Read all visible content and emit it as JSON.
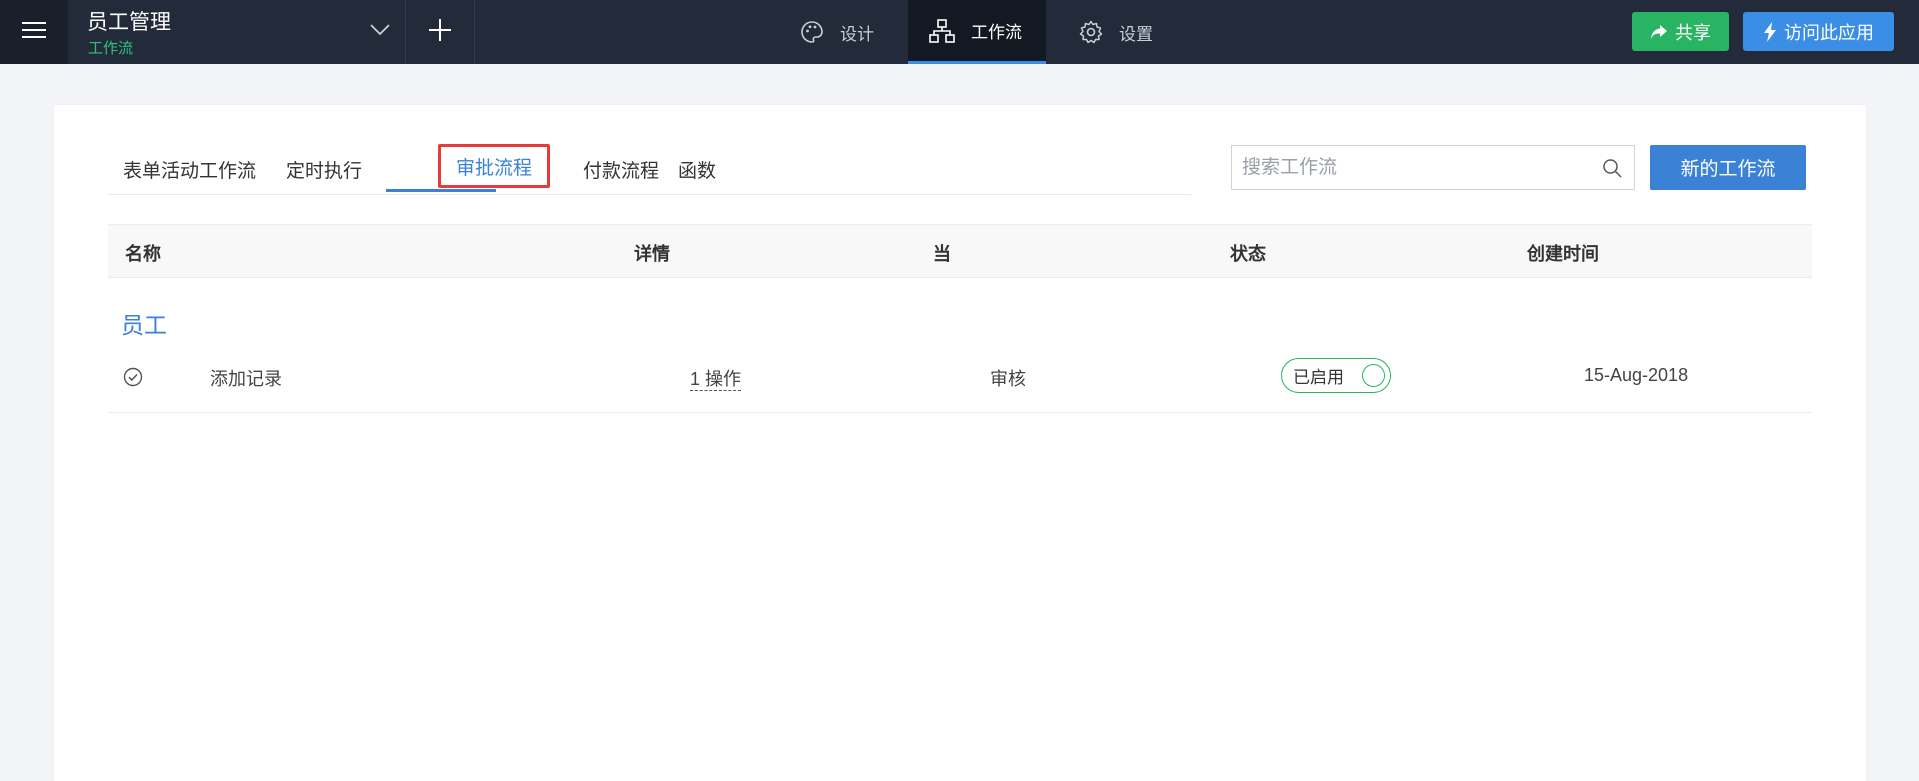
{
  "header": {
    "app_title": "员工管理",
    "app_subtitle": "工作流",
    "nav": [
      {
        "label": "设计",
        "icon": "palette-icon"
      },
      {
        "label": "工作流",
        "icon": "workflow-icon",
        "active": true
      },
      {
        "label": "设置",
        "icon": "gear-icon"
      }
    ],
    "share_label": "共享",
    "visit_label": "访问此应用",
    "colors": {
      "bar": "#232b3a",
      "share": "#28b463",
      "visit": "#3b8ee6"
    }
  },
  "subtabs": [
    {
      "label": "表单活动工作流"
    },
    {
      "label": "定时执行"
    },
    {
      "label": "审批流程",
      "active": true
    },
    {
      "label": "付款流程"
    },
    {
      "label": "函数"
    }
  ],
  "search": {
    "placeholder": "搜索工作流"
  },
  "new_button_label": "新的工作流",
  "table": {
    "columns": [
      "名称",
      "详情",
      "当",
      "状态",
      "创建时间"
    ],
    "group": "员工",
    "rows": [
      {
        "name": "添加记录",
        "detail": "1 操作",
        "when": "审核",
        "status": "已启用",
        "created": "15-Aug-2018"
      }
    ]
  }
}
